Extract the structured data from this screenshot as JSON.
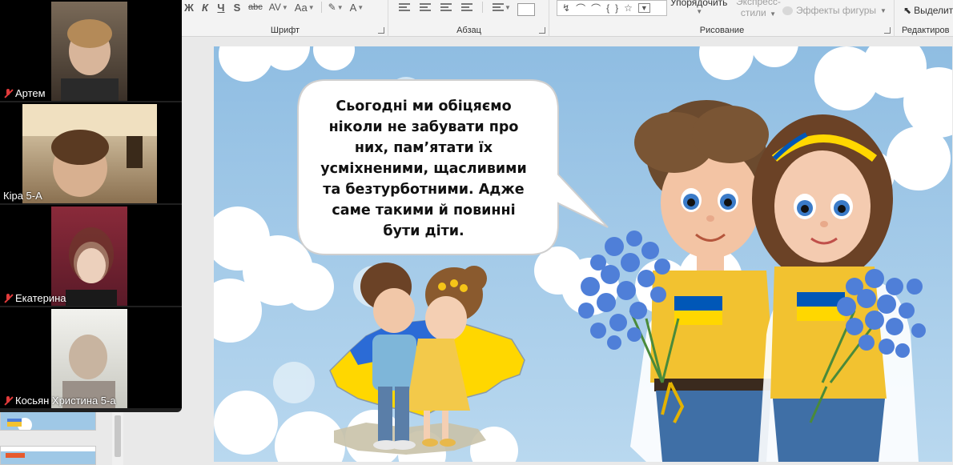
{
  "ribbon": {
    "font_group": {
      "label": "Шрифт",
      "bold": "Ж",
      "italic": "К",
      "underline": "Ч",
      "strike": "S",
      "strike_through": "abc",
      "spacing": "AV",
      "case": "Aa",
      "font_color": "A"
    },
    "paragraph_group": {
      "label": "Абзац"
    },
    "drawing_group": {
      "label": "Рисование",
      "arrange": "Упорядочить",
      "quick_styles_line1": "Экспресс-",
      "quick_styles_line2": "стили",
      "shape_effects": "Эффекты фигуры"
    },
    "editing_group": {
      "label": "Редактиров",
      "select": "Выделит"
    }
  },
  "participants": [
    {
      "name": "Артем",
      "muted": true
    },
    {
      "name": "Кіра 5-А",
      "muted": false
    },
    {
      "name": "Екатерина",
      "muted": true
    },
    {
      "name": "Косьян Христина 5-а",
      "muted": true
    }
  ],
  "slide": {
    "speech_lines": [
      "Сьогодні ми обіцяємо",
      "ніколи не забувати про",
      "них, пам’ятати їх",
      "усміхненими, щасливими",
      "та безтурботними. Адже",
      "саме такими й повинні",
      "бути діти."
    ]
  },
  "colors": {
    "sky": "#9fc8e6",
    "ukraine_blue": "#0057b7",
    "ukraine_yellow": "#ffd700",
    "shirt_yellow": "#f2c230",
    "forget_me_not": "#4f7fd8",
    "zoom_panel": "#1f1f1f",
    "muted_mic": "#e23b3b"
  }
}
